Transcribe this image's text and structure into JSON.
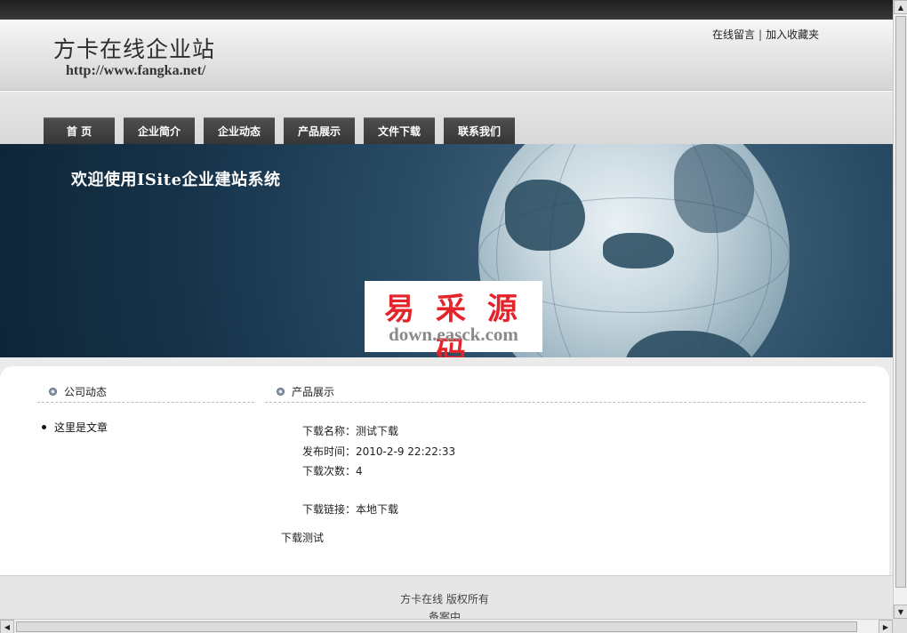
{
  "header": {
    "title": "方卡在线企业站",
    "url": "http://www.fangka.net/",
    "links": [
      "在线留言",
      "加入收藏夹"
    ],
    "separator": "|"
  },
  "nav": {
    "items": [
      "首  页",
      "企业简介",
      "企业动态",
      "产品展示",
      "文件下载",
      "联系我们"
    ]
  },
  "banner": {
    "text": "欢迎使用ISite企业建站系统",
    "watermark_cn": "易 采 源 码",
    "watermark_en": "down.easck.com"
  },
  "sidebar": {
    "title": "公司动态",
    "items": [
      "这里是文章"
    ]
  },
  "main": {
    "title": "产品展示",
    "fields": {
      "name_label": "下载名称：",
      "name_value": "测试下载",
      "time_label": "发布时间：",
      "time_value": "2010-2-9 22:22:33",
      "count_label": "下载次数：",
      "count_value": "4",
      "link_label": "下载链接：",
      "link_value": "本地下载"
    },
    "description": "下载测试"
  },
  "footer": {
    "line1": "方卡在线  版权所有",
    "line2": "备案中"
  },
  "scrollbars": {
    "up_icon": "▲",
    "down_icon": "▼",
    "left_icon": "◀",
    "right_icon": "▶"
  },
  "colors": {
    "nav_bg": "#3f3f3f",
    "banner_bg": "#1d3b52",
    "watermark_red": "#e3242b"
  }
}
